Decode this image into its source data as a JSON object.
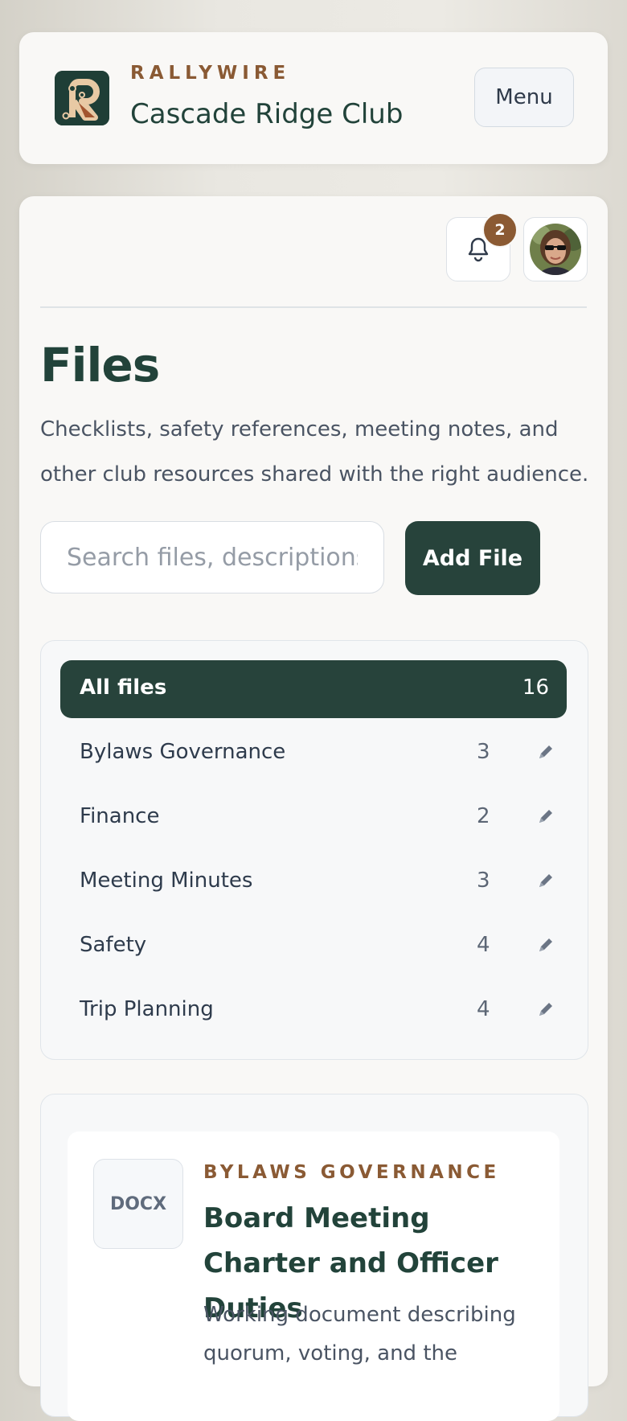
{
  "header": {
    "eyebrow": "RALLYWIRE",
    "club_name": "Cascade Ridge Club",
    "menu_label": "Menu"
  },
  "topbar": {
    "notification_count": "2"
  },
  "page": {
    "title": "Files",
    "description": "Checklists, safety references, meeting notes, and other club resources shared with the right audience."
  },
  "search": {
    "placeholder": "Search files, descriptions,"
  },
  "actions": {
    "add_file_label": "Add File"
  },
  "categories": {
    "all": {
      "label": "All files",
      "count": "16"
    },
    "items": [
      {
        "label": "Bylaws Governance",
        "count": "3"
      },
      {
        "label": "Finance",
        "count": "2"
      },
      {
        "label": "Meeting Minutes",
        "count": "3"
      },
      {
        "label": "Safety",
        "count": "4"
      },
      {
        "label": "Trip Planning",
        "count": "4"
      }
    ]
  },
  "files": [
    {
      "type": "DOCX",
      "category": "BYLAWS GOVERNANCE",
      "title": "Board Meeting Charter and Officer Duties",
      "description": "Working document describing quorum, voting, and the"
    }
  ],
  "colors": {
    "accent_dark": "#27433b",
    "accent_brown": "#8a5a34",
    "badge": "#8b5a33"
  }
}
